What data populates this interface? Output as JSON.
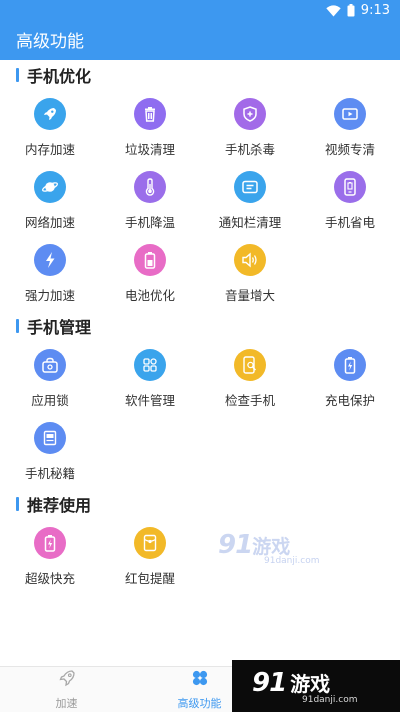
{
  "status_bar": {
    "time": "9:13"
  },
  "header": {
    "title": "高级功能"
  },
  "sections": [
    {
      "title": "手机优化",
      "items": [
        {
          "label": "内存加速",
          "icon": "rocket-icon",
          "color": "#3aa4ec"
        },
        {
          "label": "垃圾清理",
          "icon": "trash-icon",
          "color": "#8f6df0"
        },
        {
          "label": "手机杀毒",
          "icon": "shield-icon",
          "color": "#a26ae8"
        },
        {
          "label": "视频专清",
          "icon": "video-icon",
          "color": "#5d8cf2"
        },
        {
          "label": "网络加速",
          "icon": "planet-icon",
          "color": "#3aa4ec"
        },
        {
          "label": "手机降温",
          "icon": "thermometer-icon",
          "color": "#9a6eea"
        },
        {
          "label": "通知栏清理",
          "icon": "notification-icon",
          "color": "#3aa4ec"
        },
        {
          "label": "手机省电",
          "icon": "phone-battery-icon",
          "color": "#9a6eea"
        },
        {
          "label": "强力加速",
          "icon": "lightning-icon",
          "color": "#5d8cf2"
        },
        {
          "label": "电池优化",
          "icon": "battery-icon",
          "color": "#e86cc6"
        },
        {
          "label": "音量增大",
          "icon": "speaker-icon",
          "color": "#f2b928"
        }
      ]
    },
    {
      "title": "手机管理",
      "items": [
        {
          "label": "应用锁",
          "icon": "lock-icon",
          "color": "#5d8cf2"
        },
        {
          "label": "软件管理",
          "icon": "apps-grid-icon",
          "color": "#3aa4ec"
        },
        {
          "label": "检查手机",
          "icon": "phone-search-icon",
          "color": "#f2b928"
        },
        {
          "label": "充电保护",
          "icon": "charging-icon",
          "color": "#5d8cf2"
        },
        {
          "label": "手机秘籍",
          "icon": "book-icon",
          "color": "#5d8cf2"
        }
      ]
    },
    {
      "title": "推荐使用",
      "items": [
        {
          "label": "超级快充",
          "icon": "fast-charge-icon",
          "color": "#e86cc6"
        },
        {
          "label": "红包提醒",
          "icon": "red-packet-icon",
          "color": "#f2b928"
        }
      ]
    }
  ],
  "watermark": {
    "number": "91",
    "name": "游戏",
    "url": "91danji.com"
  },
  "bottom_nav": [
    {
      "label": "加速",
      "icon": "rocket-outline-icon",
      "active": false
    },
    {
      "label": "高级功能",
      "icon": "clover-icon",
      "active": true
    }
  ],
  "colors": {
    "primary": "#3d98f0",
    "nav_inactive": "#9a9a9a"
  }
}
